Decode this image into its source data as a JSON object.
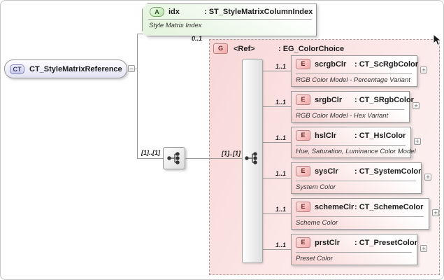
{
  "colors": {
    "attr_fill": "#e4f4de",
    "group_fill": "#f8d7d7",
    "element_fill": "#f6d3d3",
    "root_fill": "#e2e2f4",
    "line": "#999999"
  },
  "root": {
    "badge": "CT",
    "name": "CT_StyleMatrixReference",
    "collapse_glyph": "−"
  },
  "attribute": {
    "badge": "A",
    "name": "idx",
    "type": ": ST_StyleMatrixColumnIndex",
    "annotation": "Style Matrix Index"
  },
  "labels": {
    "group_cardinality": "0..1",
    "sequence_cardinality": "[1]..[1]",
    "choice_cardinality": "[1]..[1]"
  },
  "group": {
    "badge": "G",
    "name": "<Ref>",
    "type": ": EG_ColorChoice"
  },
  "elements": [
    {
      "badge": "E",
      "name": "scrgbClr",
      "type": ": CT_ScRgbColor",
      "annotation": "RGB Color Model - Percentage Variant",
      "cardinality": "1..1",
      "expand_glyph": "+"
    },
    {
      "badge": "E",
      "name": "srgbClr",
      "type": ": CT_SRgbColor",
      "annotation": "RGB Color Model - Hex Variant",
      "cardinality": "1..1",
      "expand_glyph": "+"
    },
    {
      "badge": "E",
      "name": "hslClr",
      "type": ": CT_HslColor",
      "annotation": "Hue, Saturation, Luminance Color Model",
      "cardinality": "1..1",
      "expand_glyph": "+"
    },
    {
      "badge": "E",
      "name": "sysClr",
      "type": ": CT_SystemColor",
      "annotation": "System Color",
      "cardinality": "1..1",
      "expand_glyph": "+"
    },
    {
      "badge": "E",
      "name": "schemeClr",
      "type": ": CT_SchemeColor",
      "annotation": "Scheme Color",
      "cardinality": "1..1",
      "expand_glyph": "+"
    },
    {
      "badge": "E",
      "name": "prstClr",
      "type": ": CT_PresetColor",
      "annotation": "Preset Color",
      "cardinality": "1..1",
      "expand_glyph": "+"
    }
  ]
}
